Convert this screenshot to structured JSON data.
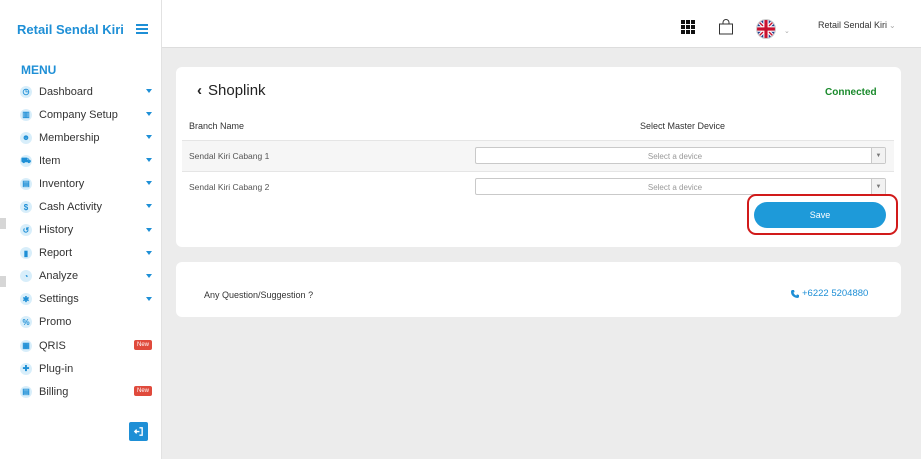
{
  "sidebar": {
    "brand": "Retail Sendal Kiri",
    "menu_title": "MENU",
    "items": [
      {
        "label": "Dashboard",
        "glyph": "◷"
      },
      {
        "label": "Company Setup",
        "glyph": "▥"
      },
      {
        "label": "Membership",
        "glyph": "☻"
      },
      {
        "label": "Item",
        "glyph": "⛟"
      },
      {
        "label": "Inventory",
        "glyph": "▤"
      },
      {
        "label": "Cash Activity",
        "glyph": "$"
      },
      {
        "label": "History",
        "glyph": "↺"
      },
      {
        "label": "Report",
        "glyph": "▮"
      },
      {
        "label": "Analyze",
        "glyph": "◔"
      },
      {
        "label": "Settings",
        "glyph": "✱"
      },
      {
        "label": "Promo",
        "glyph": "%"
      },
      {
        "label": "QRIS",
        "glyph": "▦",
        "badge": "New"
      },
      {
        "label": "Plug-in",
        "glyph": "✚"
      },
      {
        "label": "Billing",
        "glyph": "▤",
        "badge": "New"
      }
    ]
  },
  "topbar": {
    "user_name": "Retail Sendal Kiri",
    "user_caret": "⌄",
    "lang_caret": "⌄"
  },
  "shoplink": {
    "back": "‹",
    "title": "Shoplink",
    "status": "Connected",
    "status_color": "#1a8a2c",
    "columns": [
      "Branch Name",
      "Select Master Device"
    ],
    "rows": [
      {
        "branch": "Sendal Kiri Cabang 1",
        "device_placeholder": "Select a device"
      },
      {
        "branch": "Sendal Kiri Cabang 2",
        "device_placeholder": "Select a device"
      }
    ],
    "save_label": "Save"
  },
  "contact": {
    "question": "Any Question/Suggestion ?",
    "phone": "+6222 5204880"
  },
  "colors": {
    "accent": "#1e8fd6",
    "badge": "#e04a3c",
    "highlight": "#d11a1a"
  }
}
